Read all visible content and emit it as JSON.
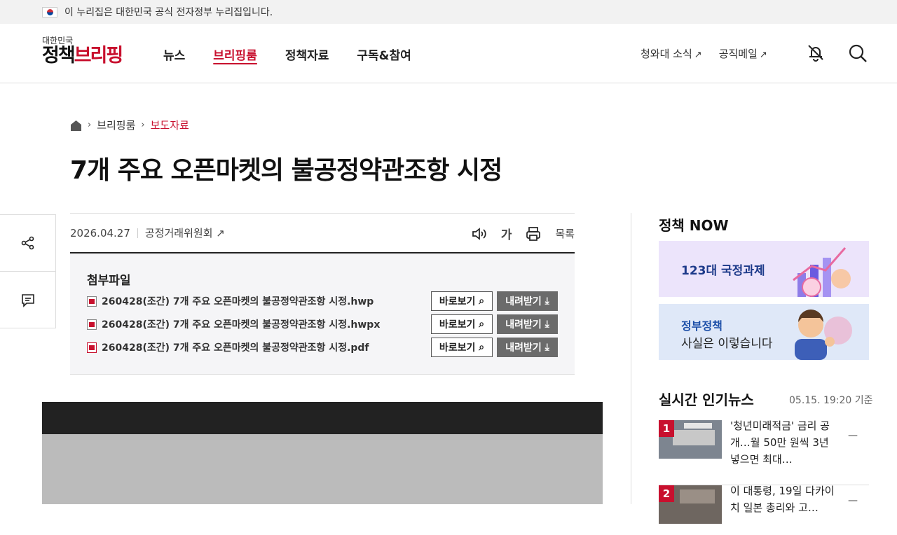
{
  "gov_bar": {
    "text": "이 누리집은 대한민국 공식 전자정부 누리집입니다."
  },
  "logo": {
    "small": "대한민국",
    "main_a": "정책",
    "main_b": "브리핑"
  },
  "nav": [
    {
      "label": "뉴스"
    },
    {
      "label": "브리핑룸",
      "active": true
    },
    {
      "label": "정책자료"
    },
    {
      "label": "구독&참여"
    }
  ],
  "header_links": [
    {
      "label": "청와대 소식"
    },
    {
      "label": "공직메일"
    }
  ],
  "breadcrumb": {
    "level1": "브리핑룸",
    "current": "보도자료"
  },
  "article": {
    "title": "7개 주요 오픈마켓의 불공정약관조항 시정",
    "date": "2026.04.27",
    "org": "공정거래위원회",
    "font_label": "가",
    "list_label": "목록"
  },
  "attachments": {
    "title": "첨부파일",
    "view_label": "바로보기",
    "download_label": "내려받기",
    "files": [
      {
        "name": "260428(조간) 7개 주요 오픈마켓의 불공정약관조항 시정.hwp",
        "type": "hwp"
      },
      {
        "name": "260428(조간) 7개 주요 오픈마켓의 불공정약관조항 시정.hwpx",
        "type": "hwpx"
      },
      {
        "name": "260428(조간) 7개 주요 오픈마켓의 불공정약관조항 시정.pdf",
        "type": "pdf"
      }
    ]
  },
  "sidebar": {
    "now_title": "정책 NOW",
    "banner1": "123대 국정과제",
    "banner2_line1": "정부정책",
    "banner2_line2": "사실은 이렇습니다",
    "popular_title": "실시간 인기뉴스",
    "popular_time": "05.15. 19:20 기준",
    "news": [
      {
        "rank": "1",
        "text": "'청년미래적금' 금리 공개…월 50만 원씩 3년 넣으면 최대…"
      },
      {
        "rank": "2",
        "text": "이 대통령, 19일 다카이치 일본 총리와 고…"
      }
    ]
  },
  "colors": {
    "accent": "#c8102e",
    "download_btn": "#6b6b6b"
  }
}
